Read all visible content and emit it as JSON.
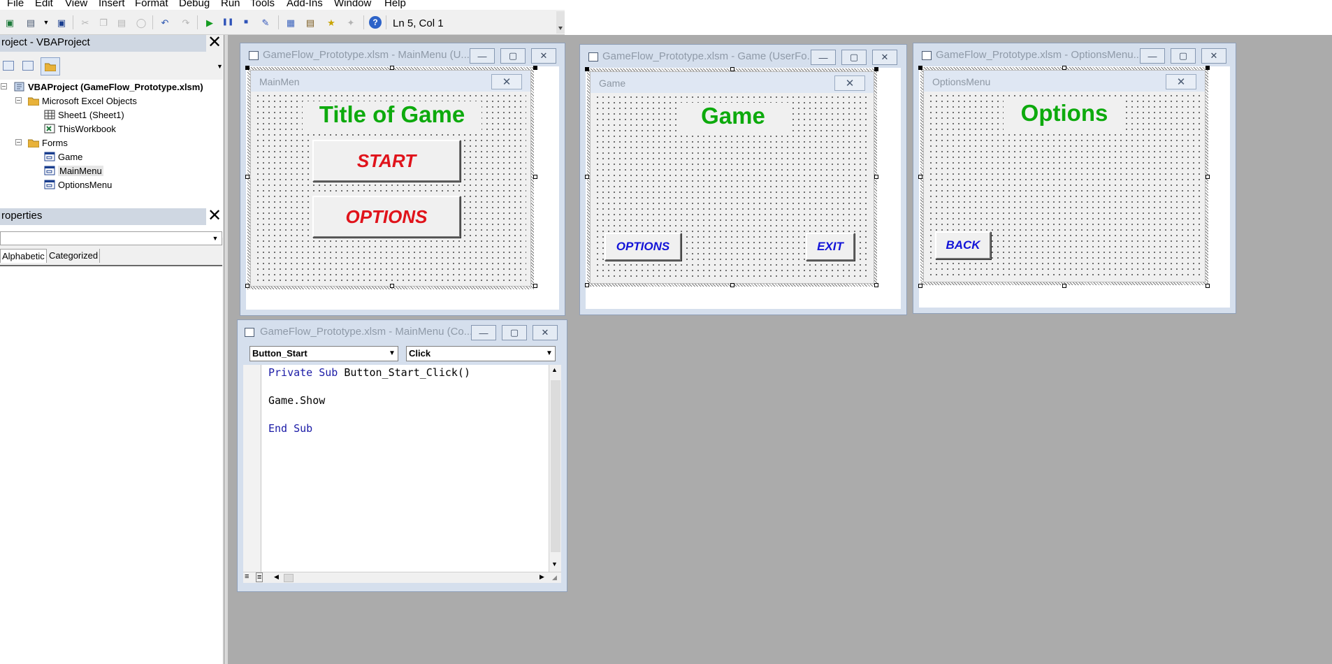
{
  "menu": [
    "File",
    "Edit",
    "View",
    "Insert",
    "Format",
    "Debug",
    "Run",
    "Tools",
    "Add-Ins",
    "Window",
    "Help"
  ],
  "toolbar": {
    "position": "Ln 5, Col 1"
  },
  "project_panel": {
    "title": "roject - VBAProject",
    "root": "VBAProject (GameFlow_Prototype.xlsm)",
    "folder_objects": "Microsoft Excel Objects",
    "sheet1": "Sheet1 (Sheet1)",
    "thisworkbook": "ThisWorkbook",
    "folder_forms": "Forms",
    "forms": [
      "Game",
      "MainMenu",
      "OptionsMenu"
    ]
  },
  "properties_panel": {
    "title": "roperties",
    "tab_alphabetic": "Alphabetic",
    "tab_categorized": "Categorized"
  },
  "windows": {
    "mainmenu": {
      "title": "GameFlow_Prototype.xlsm - MainMenu (U...",
      "form_caption": "MainMen",
      "heading": "Title of Game",
      "button1": "START",
      "button2": "OPTIONS"
    },
    "game": {
      "title": "GameFlow_Prototype.xlsm - Game (UserFo...",
      "form_caption": "Game",
      "heading": "Game",
      "button1": "OPTIONS",
      "button2": "EXIT"
    },
    "options": {
      "title": "GameFlow_Prototype.xlsm - OptionsMenu...",
      "form_caption": "OptionsMenu",
      "heading": "Options",
      "button1": "BACK"
    },
    "code": {
      "title": "GameFlow_Prototype.xlsm - MainMenu (Co...",
      "object": "Button_Start",
      "procedure": "Click",
      "line1_kw1": "Private",
      "line1_kw2": "Sub",
      "line1_rest": "Button_Start_Click()",
      "line2": "Game.Show",
      "line3": "End Sub"
    }
  },
  "colors": {
    "title_green": "#0daa0d",
    "start_red": "#e0131b",
    "button_blue": "#1314d8",
    "keyword_blue": "#1a1aa6"
  }
}
